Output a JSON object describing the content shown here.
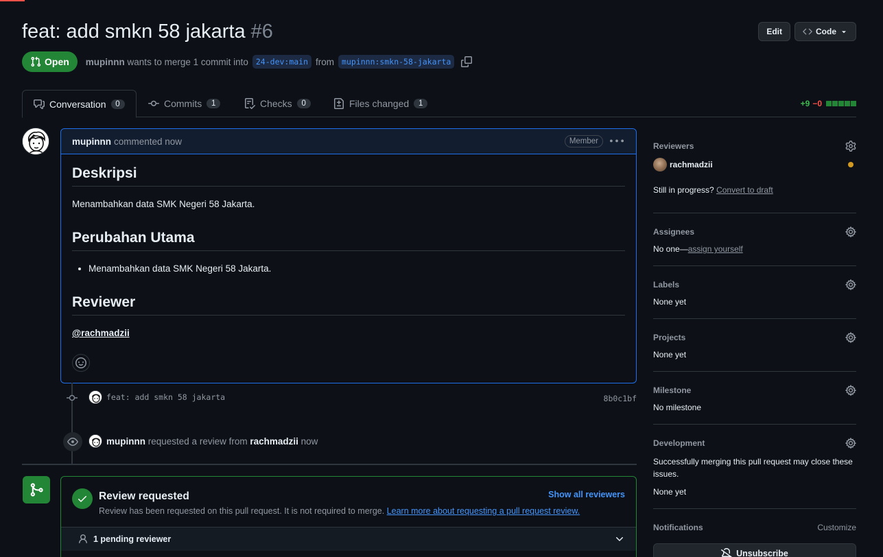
{
  "pr": {
    "title": "feat: add smkn 58 jakarta",
    "number": "#6",
    "state": "Open",
    "author": "mupinnn",
    "merge_text": "wants to merge 1 commit into",
    "base_branch": "24-dev:main",
    "from_text": "from",
    "head_branch": "mupinnn:smkn-58-jakarta"
  },
  "header_actions": {
    "edit_label": "Edit",
    "code_label": "Code"
  },
  "tabs": [
    {
      "label": "Conversation",
      "count": "0"
    },
    {
      "label": "Commits",
      "count": "1"
    },
    {
      "label": "Checks",
      "count": "0"
    },
    {
      "label": "Files changed",
      "count": "1"
    }
  ],
  "diffstat": {
    "additions": "+9",
    "deletions": "−0"
  },
  "comment": {
    "author": "mupinnn",
    "action": "commented now",
    "badge": "Member",
    "heading1": "Deskripsi",
    "para1": "Menambahkan data SMK Negeri 58 Jakarta.",
    "heading2": "Perubahan Utama",
    "bullet1": "Menambahkan data SMK Negeri 58 Jakarta.",
    "heading3": "Reviewer",
    "mention": "@rachmadzii"
  },
  "commit_event": {
    "message": "feat: add smkn 58 jakarta",
    "sha": "8b0c1bf"
  },
  "review_event": {
    "actor": "mupinnn",
    "text": "requested a review from",
    "reviewer": "rachmadzii",
    "time": "now"
  },
  "mergebox": {
    "title": "Review requested",
    "subtitle": "Review has been requested on this pull request. It is not required to merge.",
    "learn_more": "Learn more about requesting a pull request review.",
    "show_all": "Show all reviewers",
    "pending": "1 pending reviewer"
  },
  "sidebar": {
    "reviewers_head": "Reviewers",
    "reviewer_name": "rachmadzii",
    "progress_text": "Still in progress?",
    "convert_draft": "Convert to draft",
    "assignees_head": "Assignees",
    "assignees_none": "No one—",
    "assign_yourself": "assign yourself",
    "labels_head": "Labels",
    "labels_val": "None yet",
    "projects_head": "Projects",
    "projects_val": "None yet",
    "milestone_head": "Milestone",
    "milestone_val": "No milestone",
    "development_head": "Development",
    "development_desc": "Successfully merging this pull request may close these issues.",
    "development_val": "None yet",
    "notifications_head": "Notifications",
    "customize": "Customize",
    "unsubscribe": "Unsubscribe"
  },
  "colors": {
    "background": "#0d1117",
    "open_green": "#238636",
    "link_blue": "#4493f8",
    "border": "#30363d",
    "pending_yellow": "#d29922"
  }
}
